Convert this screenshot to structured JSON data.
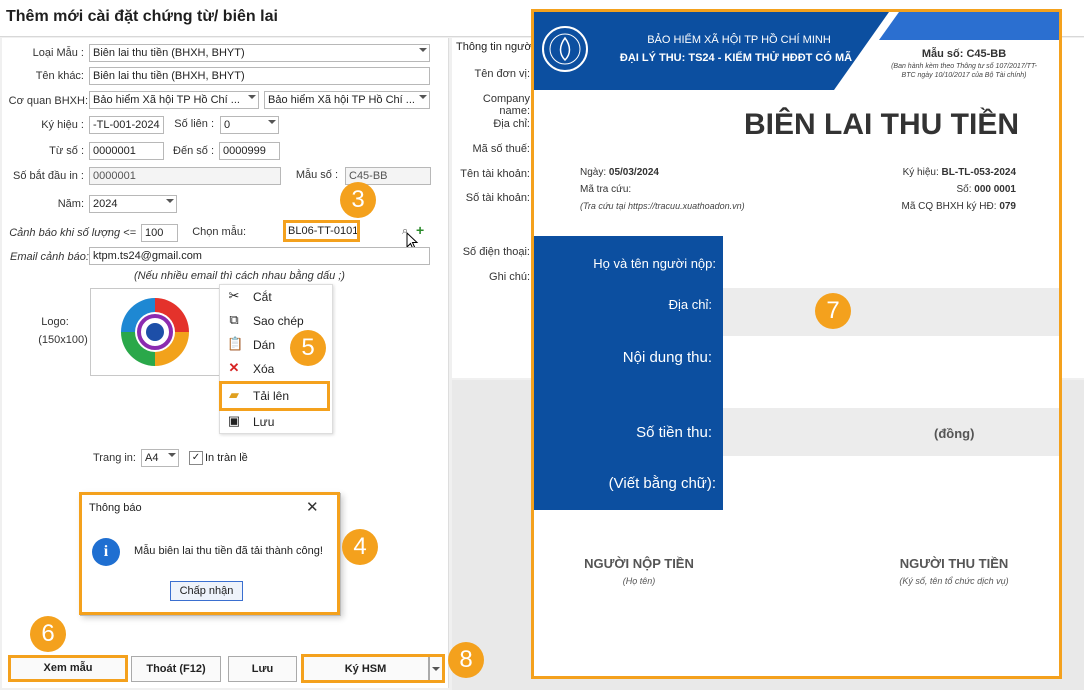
{
  "title": "Thêm mới cài đặt chứng từ/ biên lai",
  "form": {
    "loai_mau_label": "Loại Mẫu :",
    "loai_mau_value": "Biên lai thu tiền (BHXH, BHYT)",
    "ten_khac_label": "Tên khác:",
    "ten_khac_value": "Biên lai thu tiền (BHXH, BHYT)",
    "co_quan_label": "Cơ quan BHXH:",
    "co_quan_value1": "Bảo hiểm Xã hội TP Hồ Chí ...",
    "co_quan_value2": "Bảo hiểm Xã hội TP Hồ Chí ...",
    "ky_hieu_label": "Ký hiệu :",
    "ky_hieu_value": "-TL-001-2024",
    "so_lien_label": "Số liên :",
    "so_lien_value": "0",
    "tu_so_label": "Từ số :",
    "tu_so_value": "0000001",
    "den_so_label": "Đến số :",
    "den_so_value": "0000999",
    "so_bat_dau_label": "Số bắt đầu in :",
    "so_bat_dau_value": "0000001",
    "mau_so_label": "Mẫu số :",
    "mau_so_value": "C45-BB",
    "nam_label": "Năm:",
    "nam_value": "2024",
    "canh_bao_label": "Cảnh báo khi số lượng <=",
    "canh_bao_value": "100",
    "chon_mau_label": "Chọn mẫu:",
    "chon_mau_value": "BL06-TT-0101",
    "email_label": "Email cảnh báo:",
    "email_value": "ktpm.ts24@gmail.com",
    "email_note": "(Nếu nhiều email thì cách nhau bằng dấu ;)",
    "logo_label": "Logo:",
    "logo_size": "(150x100)",
    "trang_in_label": "Trang in:",
    "trang_in_value": "A4",
    "in_tran_le": "In tràn lề"
  },
  "context_menu": {
    "items": [
      {
        "label": "Cắt",
        "icon": "scissors-icon"
      },
      {
        "label": "Sao chép",
        "icon": "copy-icon"
      },
      {
        "label": "Dán",
        "icon": "paste-icon"
      },
      {
        "label": "Xóa",
        "icon": "delete-icon"
      },
      {
        "label": "Tải lên",
        "icon": "folder-open-icon"
      },
      {
        "label": "Lưu",
        "icon": "save-icon"
      }
    ]
  },
  "dialog": {
    "title": "Thông báo",
    "message": "Mẫu biên lai thu tiền đã tải thành công!",
    "ok": "Chấp nhận"
  },
  "buttons": {
    "preview": "Xem mẫu",
    "exit": "Thoát (F12)",
    "save": "Lưu",
    "sign": "Ký HSM"
  },
  "right_form": {
    "header": "Thông tin người",
    "labels": [
      "Tên đơn vị:",
      "Company name:",
      "Địa chỉ:",
      "Mã số thuế:",
      "Tên tài khoản:",
      "Số tài khoản:",
      "Số điện thoại:",
      "Ghi chú:"
    ]
  },
  "callouts": [
    "3",
    "4",
    "5",
    "6",
    "7",
    "8"
  ],
  "receipt": {
    "org": "BẢO HIỂM XÃ HỘI TP HỒ CHÍ MINH",
    "agent": "ĐẠI LÝ THU: TS24 - KIỂM THỬ HĐĐT CÓ MÃ",
    "mau_so": "Mẫu số: C45-BB",
    "mau_so_note": "(Ban hành kèm theo Thông tư số 107/2017/TT-BTC ngày 10/10/2017 của Bộ Tài chính)",
    "title": "BIÊN LAI THU TIỀN",
    "ngay_label": "Ngày:",
    "ngay_value": "05/03/2024",
    "ma_tra_cuu": "Mã tra cứu:",
    "tra_cuu_note": "(Tra cứu tại https://tracuu.xuathoadon.vn)",
    "ky_hieu_label": "Ký hiệu:",
    "ky_hieu_value": "BL-TL-053-2024",
    "so_label": "Số:",
    "so_value": "000 0001",
    "ma_cq_label": "Mã CQ BHXH ký HĐ:",
    "ma_cq_value": "079",
    "ho_ten": "Họ và tên người nộp:",
    "dia_chi": "Địa chỉ:",
    "noi_dung": "Nội dung thu:",
    "so_tien": "Số tiền thu:",
    "dong": "(đồng)",
    "bang_chu": "(Viết bằng chữ):",
    "nguoi_nop": "NGƯỜI NỘP TIỀN",
    "nguoi_nop_note": "(Họ tên)",
    "nguoi_thu": "NGƯỜI THU TIỀN",
    "nguoi_thu_note": "(Ký số, tên tổ chức dịch vụ)"
  },
  "colors": {
    "accent": "#f4a11d",
    "brand_blue": "#0c4fa0"
  }
}
